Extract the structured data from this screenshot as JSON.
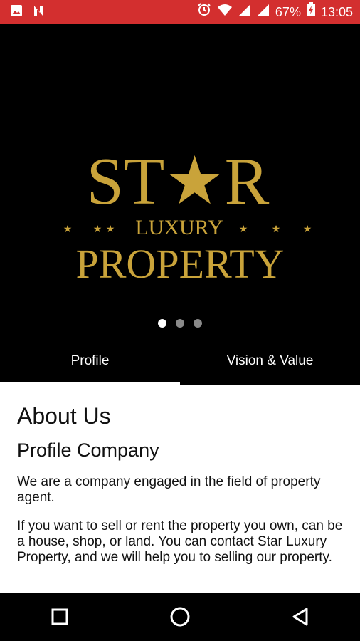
{
  "status_bar": {
    "battery": "67%",
    "time": "13:05",
    "icons": [
      "image-icon",
      "notification-n-icon",
      "alarm-icon",
      "wifi-icon",
      "signal-icon",
      "signal-icon",
      "battery-charging-icon"
    ]
  },
  "brand": {
    "line1": "ST★R",
    "line2": "LUXURY",
    "line3": "PROPERTY",
    "color": "#C9A33A"
  },
  "carousel": {
    "pages": 3,
    "active": 1
  },
  "tabs": [
    {
      "label": "Profile",
      "active": true
    },
    {
      "label": "Vision & Value",
      "active": false
    }
  ],
  "content": {
    "heading": "About Us",
    "subheading": "Profile Company",
    "para1": "We are a company engaged in the field of property agent.",
    "para2": "If you want to sell or rent the property you own, can be a house, shop,  or land. You can contact Star Luxury Property, and we will help you to selling our property."
  },
  "nav": {
    "icons": [
      "recents-square-icon",
      "home-circle-icon",
      "back-triangle-icon"
    ]
  }
}
